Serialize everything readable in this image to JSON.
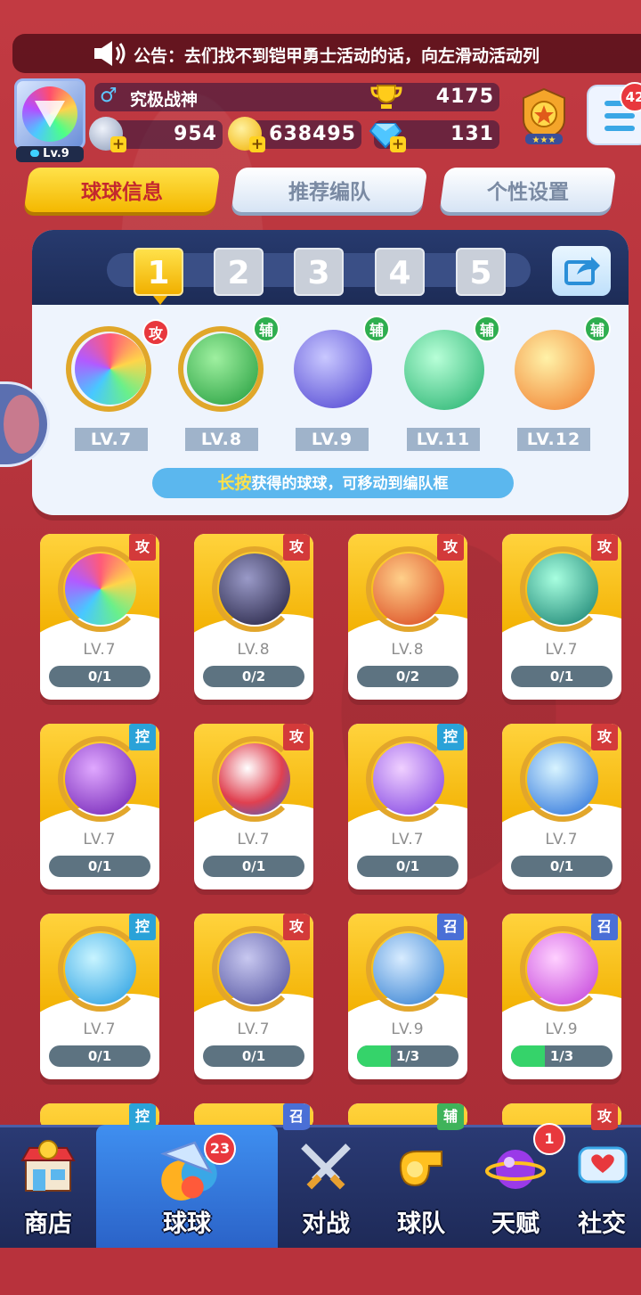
{
  "announcement": {
    "text": "公告：去们找不到铠甲勇士活动的话，向左滑动活动列"
  },
  "player": {
    "level": "Lv.9",
    "name": "究极战神",
    "trophies": "4175",
    "currency1": "954",
    "gold": "638495",
    "diamonds": "131",
    "menu_badge": "42"
  },
  "tabs": [
    {
      "label": "球球信息",
      "active": true
    },
    {
      "label": "推荐编队",
      "active": false
    },
    {
      "label": "个性设置",
      "active": false
    }
  ],
  "team": {
    "slots": [
      "1",
      "2",
      "3",
      "4",
      "5"
    ],
    "active_slot": "1",
    "balls": [
      {
        "role": "攻",
        "level": "LV.7"
      },
      {
        "role": "辅",
        "level": "LV.8"
      },
      {
        "role": "辅",
        "level": "LV.9"
      },
      {
        "role": "辅",
        "level": "LV.11"
      },
      {
        "role": "辅",
        "level": "LV.12"
      }
    ],
    "hint_highlight": "长按",
    "hint_rest": "获得的球球，可移动到编队框"
  },
  "cards": [
    {
      "role": "攻",
      "level": "LV.7",
      "progress": "0/1",
      "fill": 0
    },
    {
      "role": "攻",
      "level": "LV.8",
      "progress": "0/2",
      "fill": 0
    },
    {
      "role": "攻",
      "level": "LV.8",
      "progress": "0/2",
      "fill": 0
    },
    {
      "role": "攻",
      "level": "LV.7",
      "progress": "0/1",
      "fill": 0
    },
    {
      "role": "控",
      "level": "LV.7",
      "progress": "0/1",
      "fill": 0
    },
    {
      "role": "攻",
      "level": "LV.7",
      "progress": "0/1",
      "fill": 0
    },
    {
      "role": "控",
      "level": "LV.7",
      "progress": "0/1",
      "fill": 0
    },
    {
      "role": "攻",
      "level": "LV.7",
      "progress": "0/1",
      "fill": 0
    },
    {
      "role": "控",
      "level": "LV.7",
      "progress": "0/1",
      "fill": 0
    },
    {
      "role": "攻",
      "level": "LV.7",
      "progress": "0/1",
      "fill": 0
    },
    {
      "role": "召",
      "level": "LV.9",
      "progress": "1/3",
      "fill": 0.333
    },
    {
      "role": "召",
      "level": "LV.9",
      "progress": "1/3",
      "fill": 0.333
    }
  ],
  "partial_cards": [
    {
      "role": "控"
    },
    {
      "role": "召"
    },
    {
      "role": "辅"
    },
    {
      "role": "攻"
    }
  ],
  "nav": [
    {
      "label": "商店",
      "icon": "shop-icon",
      "badge": ""
    },
    {
      "label": "球球",
      "icon": "balls-icon",
      "badge": "23",
      "active": true
    },
    {
      "label": "对战",
      "icon": "battle-icon",
      "badge": ""
    },
    {
      "label": "球队",
      "icon": "whistle-icon",
      "badge": ""
    },
    {
      "label": "天赋",
      "icon": "talent-icon",
      "badge": "1"
    },
    {
      "label": "社交",
      "icon": "social-icon",
      "badge": ""
    }
  ]
}
